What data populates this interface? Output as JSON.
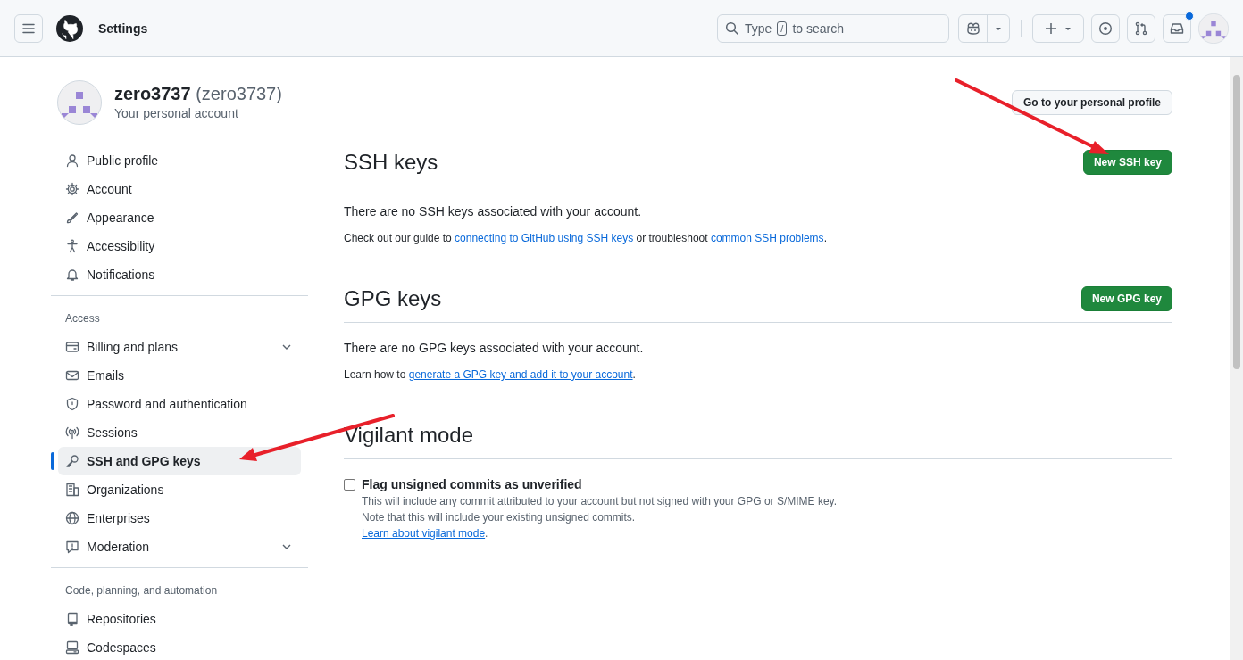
{
  "header": {
    "title": "Settings",
    "search": {
      "hint_lead": "Type",
      "key": "/",
      "hint_tail": "to search"
    },
    "inbox_unread": true
  },
  "profile": {
    "name": "zero3737",
    "login": "(zero3737)",
    "subtitle": "Your personal account",
    "profile_button": "Go to your personal profile"
  },
  "sidebar": {
    "groups": [
      {
        "items": [
          {
            "label": "Public profile",
            "kind": "link",
            "selected": false
          },
          {
            "label": "Account",
            "kind": "link",
            "selected": false
          },
          {
            "label": "Appearance",
            "kind": "link",
            "selected": false
          },
          {
            "label": "Accessibility",
            "kind": "link",
            "selected": false
          },
          {
            "label": "Notifications",
            "kind": "link",
            "selected": false
          }
        ]
      },
      {
        "heading": "Access",
        "items": [
          {
            "label": "Billing and plans",
            "kind": "group",
            "selected": false
          },
          {
            "label": "Emails",
            "kind": "link",
            "selected": false
          },
          {
            "label": "Password and authentication",
            "kind": "link",
            "selected": false
          },
          {
            "label": "Sessions",
            "kind": "link",
            "selected": false
          },
          {
            "label": "SSH and GPG keys",
            "kind": "link",
            "selected": true
          },
          {
            "label": "Organizations",
            "kind": "link",
            "selected": false
          },
          {
            "label": "Enterprises",
            "kind": "link",
            "selected": false
          },
          {
            "label": "Moderation",
            "kind": "group",
            "selected": false
          }
        ]
      },
      {
        "heading": "Code, planning, and automation",
        "items": [
          {
            "label": "Repositories",
            "kind": "link",
            "selected": false
          },
          {
            "label": "Codespaces",
            "kind": "link",
            "selected": false
          }
        ]
      }
    ]
  },
  "sections": [
    {
      "title": "SSH keys",
      "button": "New SSH key",
      "empty_text": "There are no SSH keys associated with your account.",
      "help": [
        {
          "kind": "text",
          "text": "Check out our guide to "
        },
        {
          "kind": "link",
          "text": "connecting to GitHub using SSH keys"
        },
        {
          "kind": "text",
          "text": " or troubleshoot "
        },
        {
          "kind": "link",
          "text": "common SSH problems"
        },
        {
          "kind": "text",
          "text": "."
        }
      ]
    },
    {
      "title": "GPG keys",
      "button": "New GPG key",
      "empty_text": "There are no GPG keys associated with your account.",
      "help": [
        {
          "kind": "text",
          "text": "Learn how to "
        },
        {
          "kind": "link",
          "text": "generate a GPG key and add it to your account"
        },
        {
          "kind": "text",
          "text": "."
        }
      ]
    }
  ],
  "vigilant": {
    "title": "Vigilant mode",
    "option": {
      "label": "Flag unsigned commits as unverified",
      "checked": false,
      "description": [
        "This will include any commit attributed to your account but not signed with your GPG or S/MIME key.",
        "Note that this will include your existing unsigned commits."
      ],
      "link": "Learn about vigilant mode",
      "link_tail": "."
    }
  }
}
